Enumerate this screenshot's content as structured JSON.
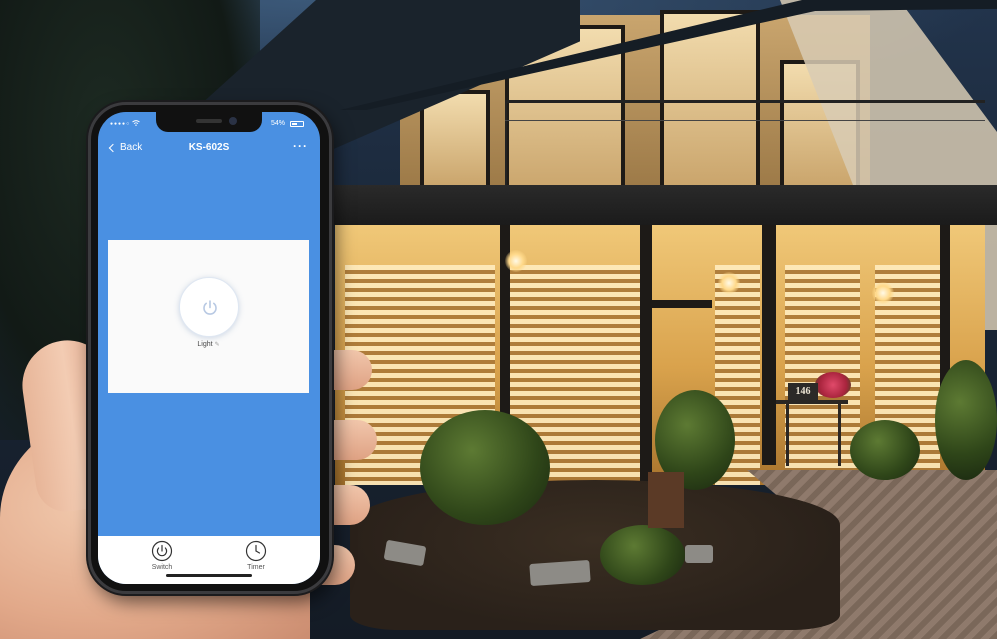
{
  "scene": {
    "house_number": "146"
  },
  "phone": {
    "status_bar": {
      "signal": "●●●●○",
      "wifi_icon": "wifi-icon",
      "battery_text": "54%",
      "battery_level": 0.54
    },
    "nav": {
      "back_label": "Back",
      "title": "KS-602S",
      "more_label": "···"
    },
    "switch": {
      "label": "Light",
      "edit_icon": "✎"
    },
    "tabs": [
      {
        "label": "Switch",
        "icon": "power-icon"
      },
      {
        "label": "Timer",
        "icon": "clock-icon"
      }
    ],
    "colors": {
      "app_blue": "#4a90e2",
      "card_bg": "#fafafa",
      "power_icon": "#b8c9e3"
    }
  }
}
